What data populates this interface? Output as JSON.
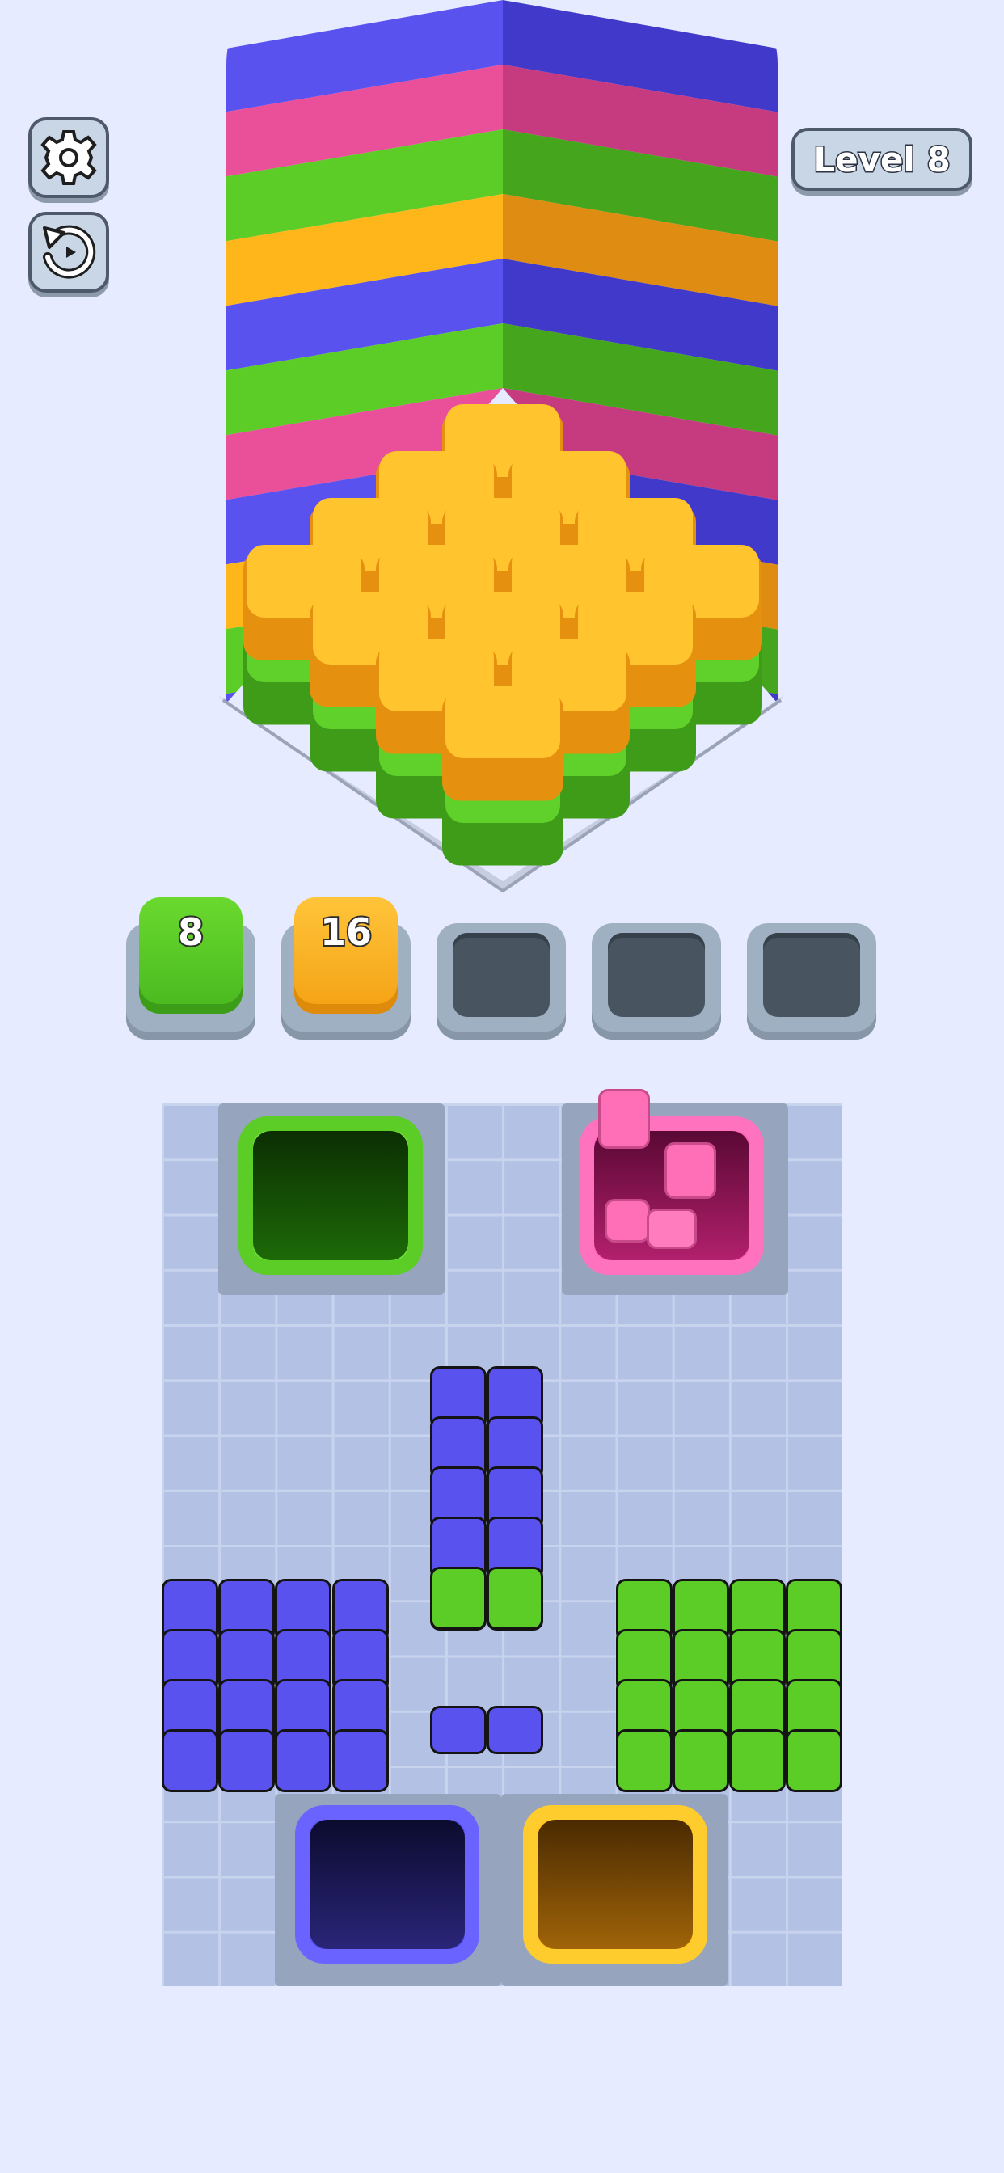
{
  "header": {
    "level_label": "Level 8"
  },
  "controls": {
    "settings_icon": "gear-icon",
    "restart_icon": "restart-icon"
  },
  "tray": {
    "slots": [
      {
        "state": "filled",
        "color": "#5ccc26",
        "count": "8"
      },
      {
        "state": "filled",
        "color": "#ffb61a",
        "count": "16"
      },
      {
        "state": "empty"
      },
      {
        "state": "empty"
      },
      {
        "state": "empty"
      }
    ]
  },
  "board": {
    "holes": [
      {
        "name": "green-hole",
        "color": "#5ccc26"
      },
      {
        "name": "pink-hole",
        "color": "#ff5fb0"
      },
      {
        "name": "blue-hole",
        "color": "#5a52ee"
      },
      {
        "name": "yellow-hole",
        "color": "#ffc21a"
      }
    ],
    "stacks": [
      {
        "name": "left-stack",
        "top_color": "#5a52ee",
        "bottom_color": "#ea4f9a"
      },
      {
        "name": "middle-stack",
        "top_color": "#5a52ee",
        "bottom_color": "#5ccc26"
      },
      {
        "name": "right-stack",
        "top_color": "#5ccc26",
        "bottom_color": "#5a52ee"
      }
    ]
  },
  "colors": {
    "blue": "#5a52ee",
    "pink": "#ea4f9a",
    "green": "#5ccc26",
    "orange": "#ffb61a",
    "background": "#e6ebff"
  }
}
